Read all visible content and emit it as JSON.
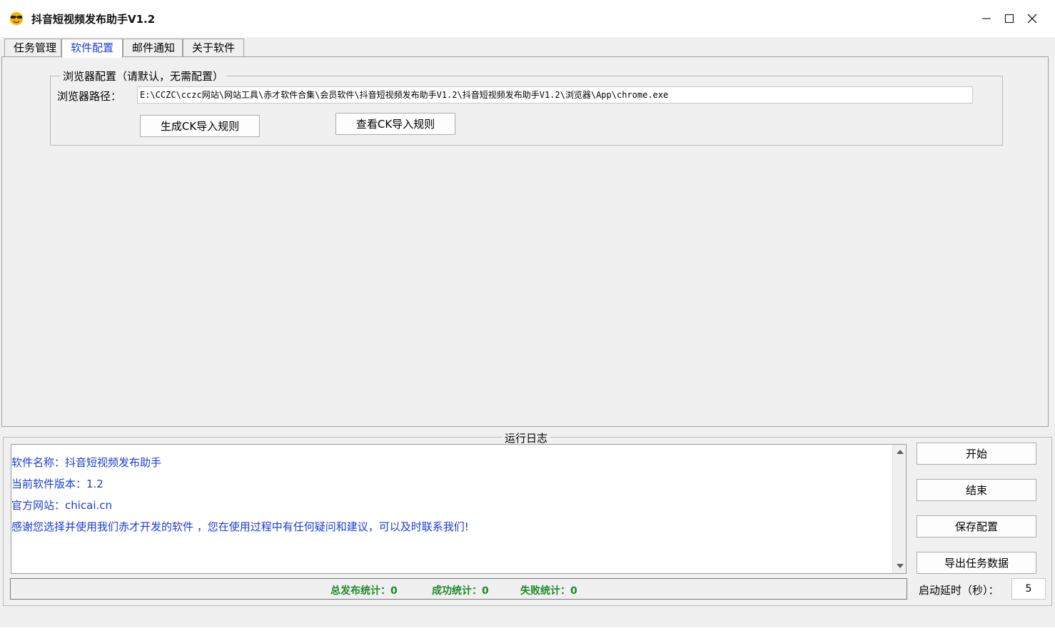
{
  "window": {
    "title": "抖音短视频发布助手V1.2",
    "icon": "sunglasses-emoji-icon"
  },
  "tabs": [
    {
      "label": "任务管理",
      "active": false
    },
    {
      "label": "软件配置",
      "active": true
    },
    {
      "label": "邮件通知",
      "active": false
    },
    {
      "label": "关于软件",
      "active": false
    }
  ],
  "browser_config": {
    "group_title": "浏览器配置（请默认，无需配置）",
    "path_label": "浏览器路径：",
    "path_value": "E:\\CCZC\\cczc网站\\网站工具\\赤才软件合集\\会员软件\\抖音短视频发布助手V1.2\\抖音短视频发布助手V1.2\\浏览器\\App\\chrome.exe",
    "generate_ck_button": "生成CK导入规则",
    "view_ck_button": "查看CK导入规则"
  },
  "log": {
    "title": "运行日志",
    "lines": [
      "软件名称：抖音短视频发布助手",
      "当前软件版本：1.2",
      "官方网站：chicai.cn",
      "感谢您选择并使用我们赤才开发的软件 ，您在使用过程中有任何疑问和建议，可以及时联系我们!"
    ]
  },
  "actions": {
    "start": "开始",
    "stop": "结束",
    "save_config": "保存配置",
    "export_tasks": "导出任务数据"
  },
  "stats": {
    "total": "总发布统计：0",
    "success": "成功统计：0",
    "failed": "失败统计：0"
  },
  "delay": {
    "label": "启动延时（秒）：",
    "value": "5"
  },
  "colors": {
    "log_text": "#1a3fd0",
    "stat_text": "#1f8a2a",
    "active_tab_text": "#1a3fd0"
  }
}
